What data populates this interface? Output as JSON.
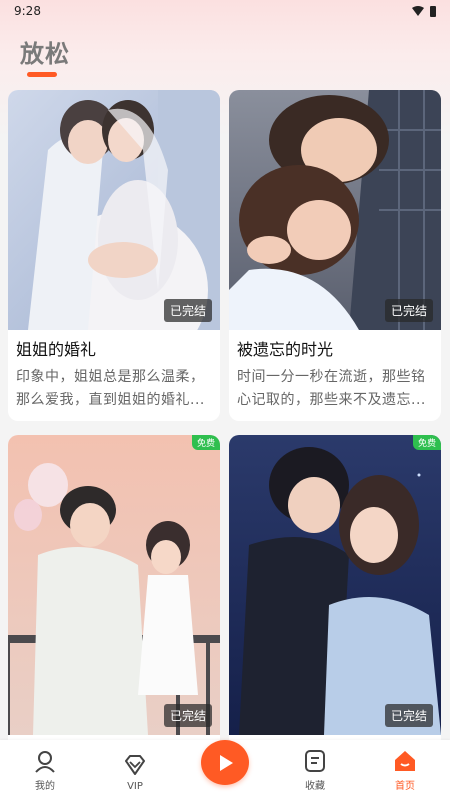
{
  "status_bar": {
    "time": "9:28"
  },
  "header": {
    "title": "放松"
  },
  "cards": [
    {
      "title": "姐姐的婚礼",
      "desc": "印象中，姐姐总是那么温柔，那么爱我，直到姐姐的婚礼...",
      "status": "已完结",
      "free": ""
    },
    {
      "title": "被遗忘的时光",
      "desc": "时间一分一秒在流逝，那些铭心记取的，那些来不及遗忘...",
      "status": "已完结",
      "free": ""
    },
    {
      "title": "",
      "desc": "",
      "status": "已完结",
      "free": "免费"
    },
    {
      "title": "",
      "desc": "",
      "status": "已完结",
      "free": "免费"
    }
  ],
  "bottom_nav": {
    "items": [
      {
        "label": "我的",
        "icon": "person-icon"
      },
      {
        "label": "VIP",
        "icon": "vip-diamond-icon"
      },
      {
        "label": "",
        "icon": "play-icon"
      },
      {
        "label": "收藏",
        "icon": "bookmark-list-icon"
      },
      {
        "label": "首页",
        "icon": "home-icon",
        "active": true
      }
    ]
  },
  "colors": {
    "accent": "#ff5a24",
    "free_badge": "#2fbf4f"
  }
}
